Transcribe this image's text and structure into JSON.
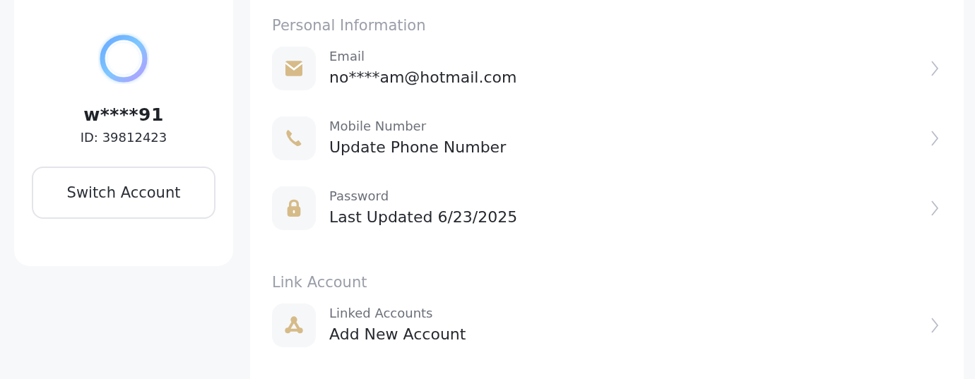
{
  "profile": {
    "username": "w****91",
    "id_text": "ID: 39812423",
    "button": "Switch Account"
  },
  "sections": [
    {
      "title": "Personal Information",
      "items": [
        {
          "kind": "email",
          "label": "Email",
          "value": "no****am@hotmail.com"
        },
        {
          "kind": "phone",
          "label": "Mobile Number",
          "value": "Update Phone Number"
        },
        {
          "kind": "password",
          "label": "Password",
          "value": "Last Updated 6/23/2025"
        }
      ]
    },
    {
      "title": "Link Account",
      "items": [
        {
          "kind": "link",
          "label": "Linked Accounts",
          "value": "Add New Account"
        }
      ]
    }
  ]
}
